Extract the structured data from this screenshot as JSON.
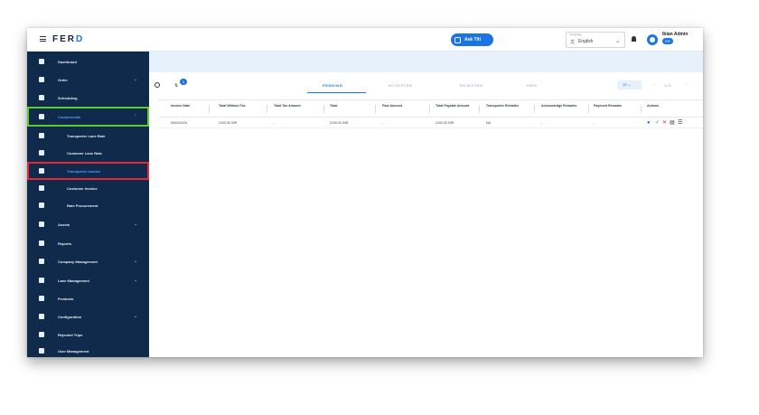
{
  "header": {
    "logo": "FERD",
    "ask_button": "Ask Titi",
    "language_caption": "Language",
    "language_value": "English",
    "user_name": "Ibian Admin",
    "user_badge": "ER"
  },
  "sidebar": {
    "items": [
      {
        "label": "Dashboard",
        "icon": "grid-icon"
      },
      {
        "label": "Order",
        "icon": "cart-icon",
        "chevron": "⌄"
      },
      {
        "label": "Scheduling",
        "icon": "calendar-icon"
      },
      {
        "label": "Commercials",
        "icon": "commercials-icon",
        "chevron": "⌃"
      },
      {
        "label": "Transporter Lane Rate",
        "icon": "truck-icon"
      },
      {
        "label": "Customer Lane Rate",
        "icon": "rate-icon"
      },
      {
        "label": "Transporter Invoice",
        "icon": "invoice-icon"
      },
      {
        "label": "Customer Invoice",
        "icon": "document-icon"
      },
      {
        "label": "Rate Procurement",
        "icon": "procurement-icon"
      },
      {
        "label": "Assets",
        "icon": "assets-icon",
        "chevron": "⌄"
      },
      {
        "label": "Reports",
        "icon": "reports-icon"
      },
      {
        "label": "Company Management",
        "icon": "company-icon",
        "chevron": "⌄"
      },
      {
        "label": "Lane Management",
        "icon": "lane-icon",
        "chevron": "⌄"
      },
      {
        "label": "Products",
        "icon": "products-icon"
      },
      {
        "label": "Configuration",
        "icon": "gear-icon",
        "chevron": "⌄"
      },
      {
        "label": "Rejected Trips",
        "icon": "rejected-icon"
      },
      {
        "label": "User Management",
        "icon": "users-icon"
      }
    ]
  },
  "toolbar": {
    "filter_badge": "0",
    "tabs": [
      "PENDING",
      "ACCEPTED",
      "REJECTED",
      "PAID"
    ],
    "page_size": "15",
    "pager_text": "1 / 1"
  },
  "table": {
    "columns": [
      "Invoice Date",
      "Total Without Tax",
      "Total Tax Amount",
      "Total",
      "Paid Amount",
      "Total Payable Amount",
      "Transporter Remarks",
      "Acknowledge Remarks",
      "Payment Remarks",
      "Actions"
    ],
    "rows": [
      [
        "06/04/2024",
        "2100.00 INR",
        "-",
        "2100.00 INR",
        "-",
        "2100.00 INR",
        "NA",
        "-",
        "-"
      ]
    ]
  },
  "colors": {
    "sidebar_bg": "#0f2a4a",
    "accent": "#1b74e4",
    "highlight_green": "#5ccb32",
    "highlight_red": "#e5293a"
  }
}
